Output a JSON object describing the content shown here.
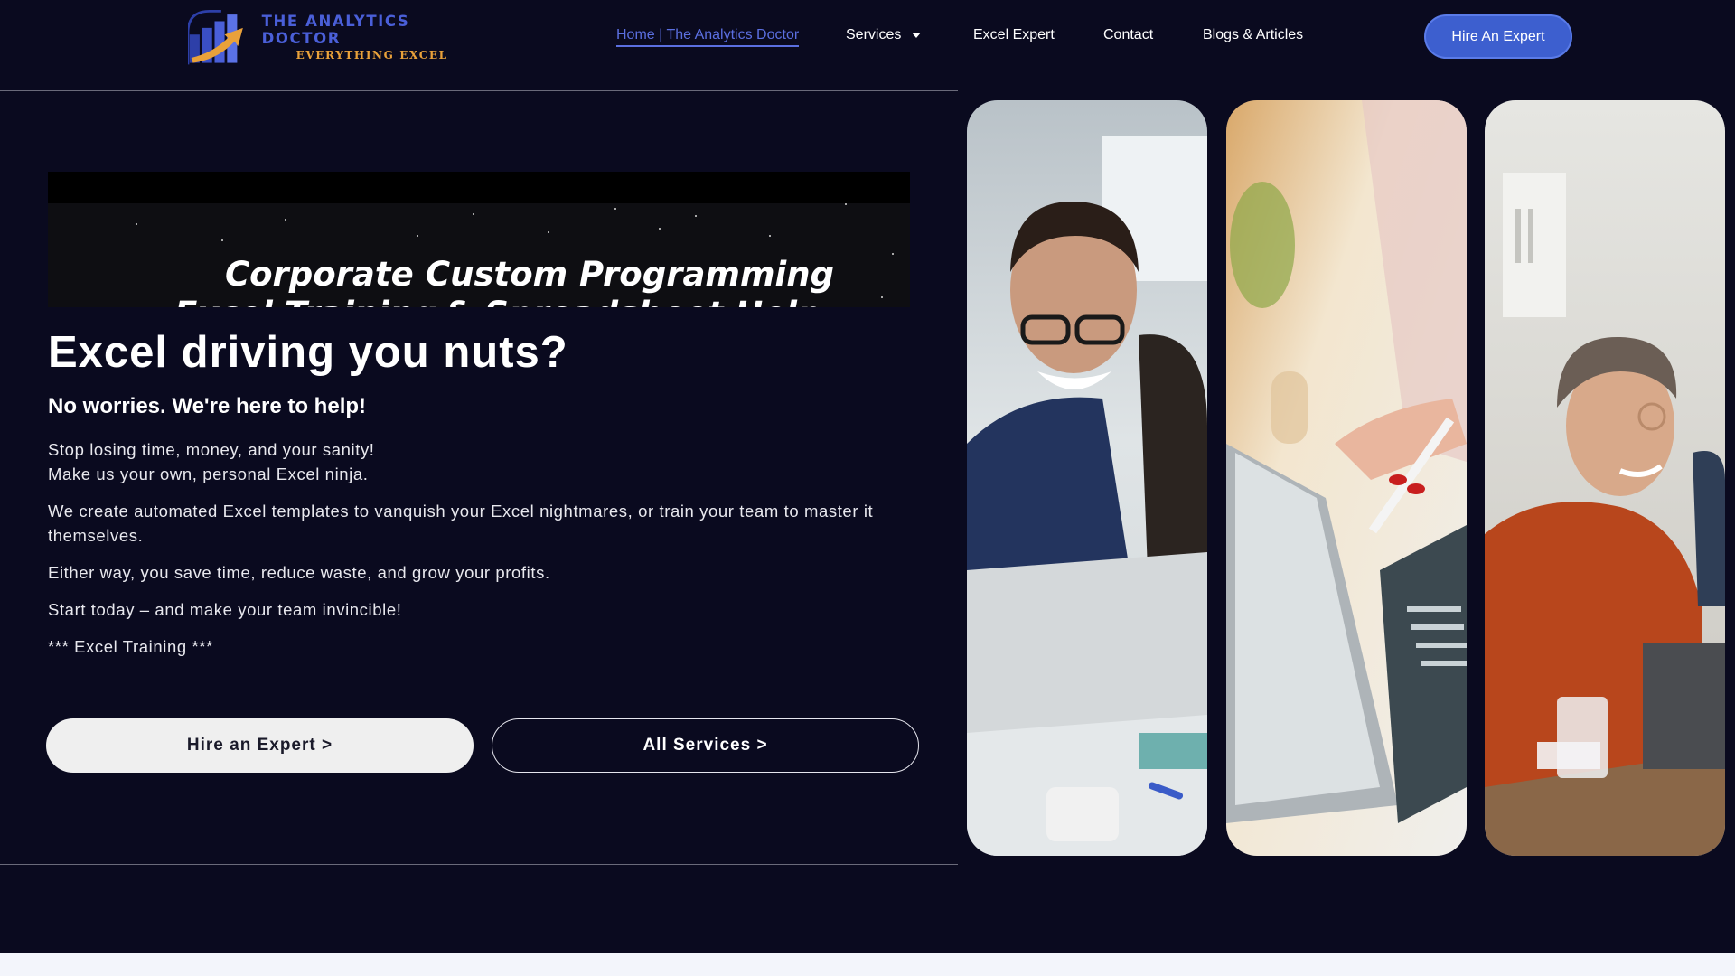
{
  "brand": {
    "title": "THE ANALYTICS DOCTOR",
    "subtitle": "EVERYTHING EXCEL"
  },
  "nav": {
    "items": [
      {
        "label": "Home | The Analytics Doctor",
        "active": true
      },
      {
        "label": "Services",
        "has_dropdown": true
      },
      {
        "label": "Excel Expert"
      },
      {
        "label": "Contact"
      },
      {
        "label": "Blogs & Articles"
      }
    ],
    "cta": "Hire An Expert"
  },
  "banner": {
    "line_left": "Corporate",
    "line_right": "Custom Programming",
    "line_left_cut": "Excel Training",
    "line_right_cut": "& Spreadsheet Help"
  },
  "hero": {
    "heading": "Excel driving you nuts?",
    "subheading": "No worries. We're here to help!",
    "paragraph_1_line_1": "Stop losing time, money, and your sanity!",
    "paragraph_1_line_2": "Make us your own, personal Excel ninja.",
    "paragraph_2": "We create automated Excel templates to vanquish your Excel nightmares, or train your team to master it themselves.",
    "paragraph_3": "Either way, you save time, reduce waste, and grow your profits.",
    "paragraph_4": "Start today – and make your team invincible!",
    "paragraph_5": "*** Excel Training ***"
  },
  "buttons": {
    "primary": "Hire an Expert >",
    "secondary": "All Services >"
  },
  "colors": {
    "background": "#0a0a1f",
    "accent_blue": "#3d5fcf",
    "link_blue": "#5b6fe0",
    "logo_orange": "#e9a13a"
  }
}
